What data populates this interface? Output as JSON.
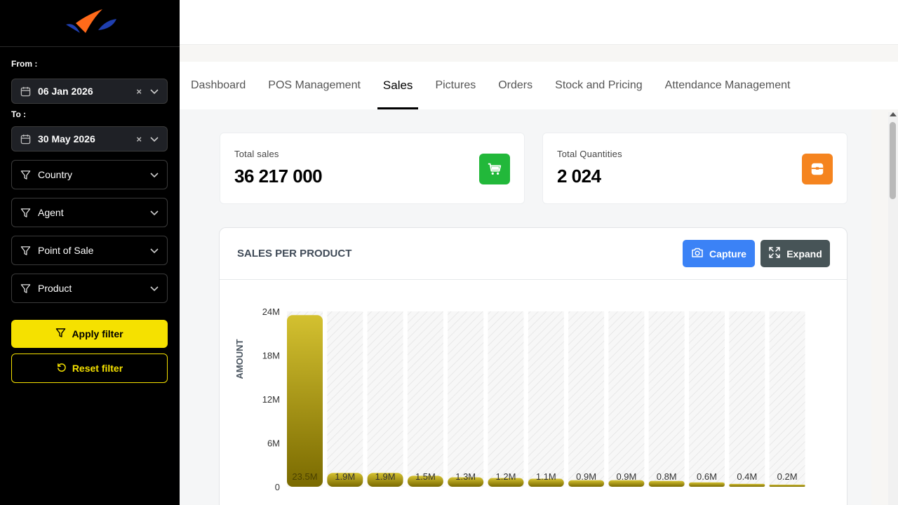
{
  "sidebar": {
    "from_label": "From :",
    "from_value": "06 Jan 2026",
    "to_label": "To :",
    "to_value": "30 May 2026",
    "clear_glyph": "×",
    "filters": {
      "country": "Country",
      "agent": "Agent",
      "point_of_sale": "Point of Sale",
      "product": "Product"
    },
    "apply_label": "Apply filter",
    "reset_label": "Reset filter"
  },
  "tabs": [
    {
      "label": "Dashboard",
      "active": false
    },
    {
      "label": "POS Management",
      "active": false
    },
    {
      "label": "Sales",
      "active": true
    },
    {
      "label": "Pictures",
      "active": false
    },
    {
      "label": "Orders",
      "active": false
    },
    {
      "label": "Stock and Pricing",
      "active": false
    },
    {
      "label": "Attendance Management",
      "active": false
    }
  ],
  "stats": {
    "total_sales_label": "Total sales",
    "total_sales_value": "36 217 000",
    "total_sales_icon": "cart-icon",
    "total_sales_color": "#22b83a",
    "total_quantities_label": "Total Quantities",
    "total_quantities_value": "2 024",
    "total_quantities_icon": "box-icon",
    "total_quantities_color": "#f5841f"
  },
  "chart_panel": {
    "title": "SALES PER PRODUCT",
    "capture_label": "Capture",
    "expand_label": "Expand",
    "capture_color": "#3b82f6",
    "expand_color": "#475457"
  },
  "chart_data": {
    "type": "bar",
    "title": "SALES PER PRODUCT",
    "xlabel": "",
    "ylabel": "AMOUNT",
    "ylim": [
      0,
      24000000
    ],
    "y_ticks": [
      "0",
      "6M",
      "12M",
      "18M",
      "24M"
    ],
    "y_tick_values": [
      0,
      6000000,
      12000000,
      18000000,
      24000000
    ],
    "categories": [],
    "values": [
      23500000,
      1900000,
      1900000,
      1500000,
      1300000,
      1200000,
      1100000,
      900000,
      900000,
      800000,
      600000,
      400000,
      200000
    ],
    "data_labels": [
      "23.5M",
      "1.9M",
      "1.9M",
      "1.5M",
      "1.3M",
      "1.2M",
      "1.1M",
      "0.9M",
      "0.9M",
      "0.8M",
      "0.6M",
      "0.4M",
      "0.2M"
    ],
    "bar_color_top": "#d4c130",
    "bar_color_bottom": "#7a6a00",
    "grid": false
  }
}
